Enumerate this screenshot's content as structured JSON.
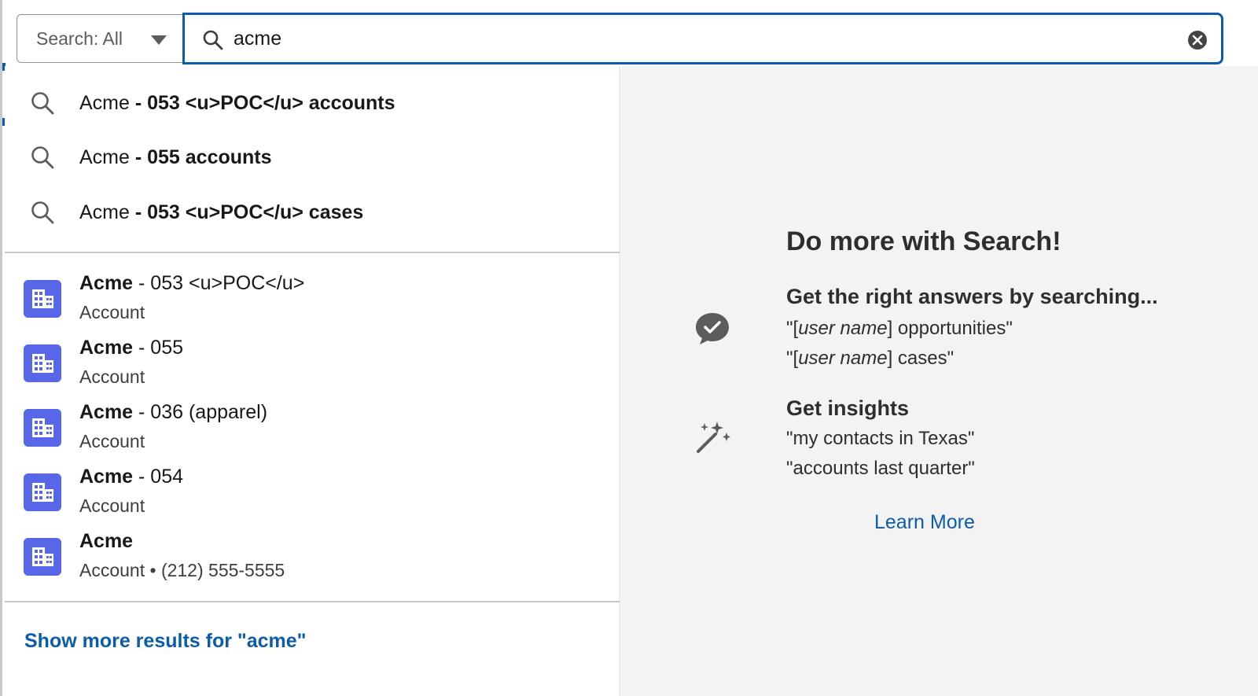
{
  "search": {
    "scope_label": "Search: All",
    "query": "acme"
  },
  "suggestions": [
    {
      "prefix": "Acme",
      "rest": " - 053 <u>POC</u> accounts"
    },
    {
      "prefix": "Acme",
      "rest": " - 055 accounts"
    },
    {
      "prefix": "Acme",
      "rest": " - 053 <u>POC</u> cases"
    }
  ],
  "results": [
    {
      "name": "Acme",
      "rest": " - 053 <u>POC</u>",
      "sub": "Account"
    },
    {
      "name": "Acme",
      "rest": " - 055",
      "sub": "Account"
    },
    {
      "name": "Acme",
      "rest": " - 036 (apparel)",
      "sub": "Account"
    },
    {
      "name": "Acme",
      "rest": " - 054",
      "sub": "Account"
    },
    {
      "name": "Acme",
      "rest": "",
      "sub": "Account • (212) 555-5555"
    }
  ],
  "show_more": "Show more results for \"acme\"",
  "help": {
    "title": "Do more with Search!",
    "section1": {
      "heading": "Get the right answers by searching...",
      "line1_open": "\"[",
      "line1_em": "user name",
      "line1_close": "] opportunities\"",
      "line2_open": "\"[",
      "line2_em": "user name",
      "line2_close": "] cases\""
    },
    "section2": {
      "heading": "Get insights",
      "line1": "\"my contacts in Texas\"",
      "line2": "\"accounts last quarter\""
    },
    "learn_more": "Learn More"
  },
  "colors": {
    "accent": "#0b5cab",
    "account_icon": "#5867e8",
    "panel_bg": "#f3f3f3"
  }
}
